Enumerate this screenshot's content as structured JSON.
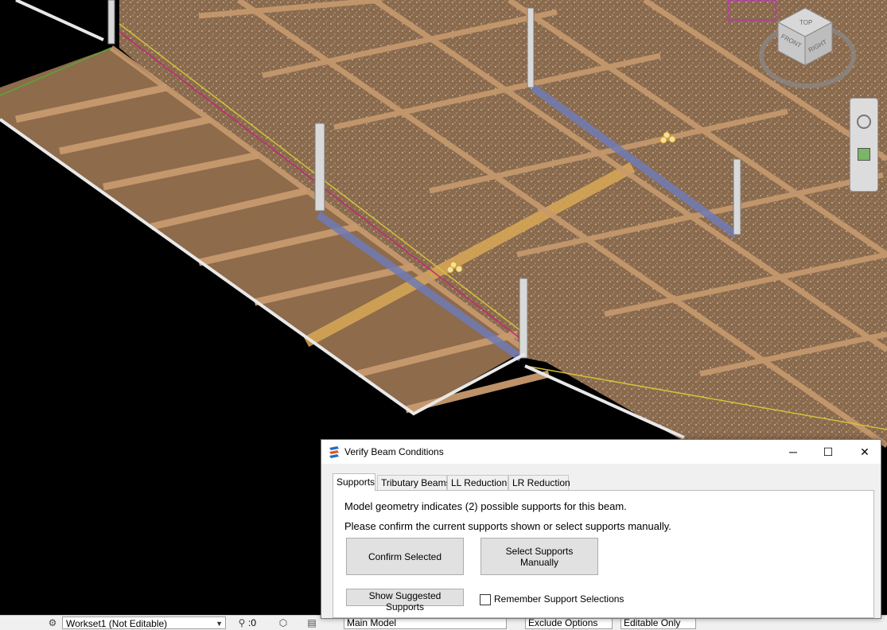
{
  "dialog": {
    "title": "Verify Beam Conditions",
    "app_icon": "app-logo-icon",
    "window_controls": {
      "minimize": "─",
      "maximize": "☐",
      "close": "✕"
    },
    "tabs": [
      {
        "label": "Supports",
        "active": true
      },
      {
        "label": "Tributary Beams",
        "active": false
      },
      {
        "label": "LL Reduction",
        "active": false
      },
      {
        "label": "LR Reduction",
        "active": false
      }
    ],
    "message_line1": "Model geometry indicates (2) possible supports for this beam.",
    "message_line2": "Please confirm the current supports shown or select supports manually.",
    "confirm_label": "Confirm Selected",
    "select_manually_label": "Select Supports Manually",
    "show_suggested_label": "Show Suggested Supports",
    "remember_label": "Remember Support Selections",
    "remember_checked": false
  },
  "statusbar": {
    "workset_value": "Workset1 (Not Editable)",
    "selection_count": ":0",
    "design_option": "Main Model",
    "exclude_options": "Exclude Options",
    "editable_only": "Editable Only"
  },
  "viewcube": {
    "top": "TOP",
    "front": "FRONT",
    "right": "RIGHT"
  },
  "colors": {
    "background": "#000000",
    "slab": "#8d6b4b",
    "beam": "#c89a6e",
    "highlight_beam": "#d9a957",
    "support_highlight": "#6f7bb5",
    "annotation_arrow": "#e8413b",
    "dialog_bg": "#f0f0f0"
  }
}
